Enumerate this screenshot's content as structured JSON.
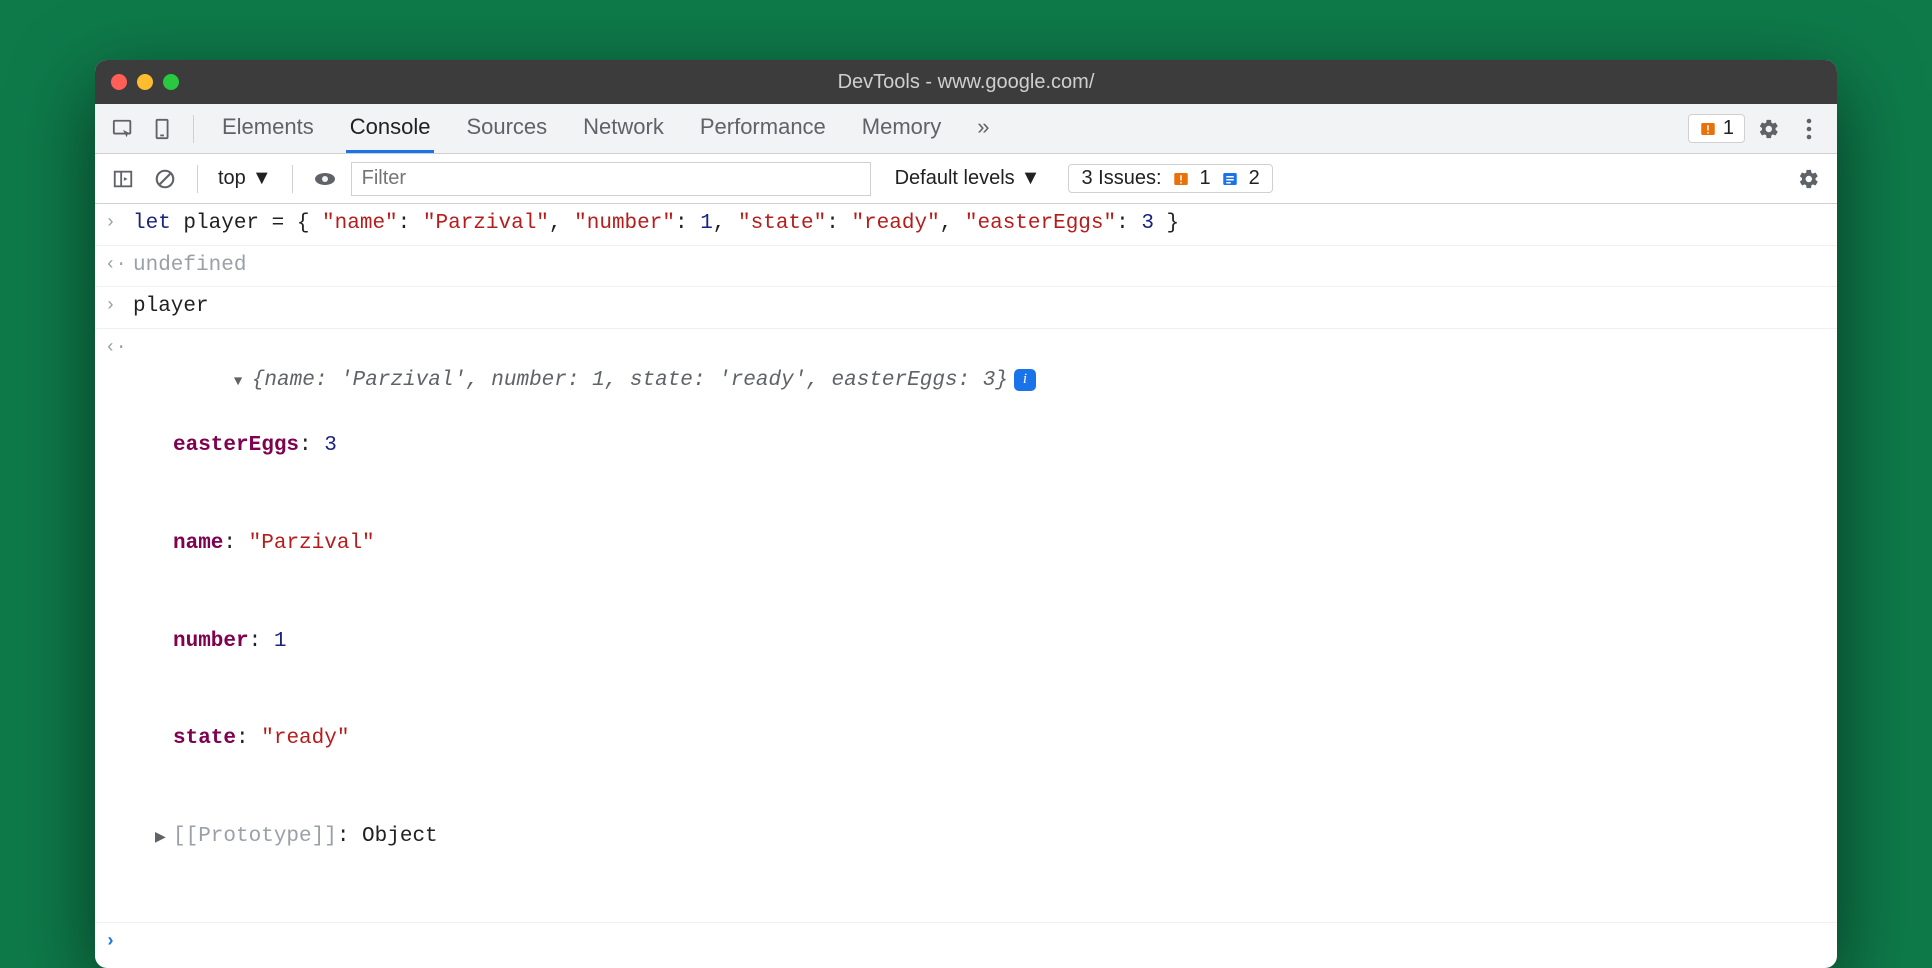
{
  "window": {
    "title": "DevTools - www.google.com/"
  },
  "tabs": {
    "items": [
      "Elements",
      "Console",
      "Sources",
      "Network",
      "Performance",
      "Memory"
    ],
    "active": "Console"
  },
  "toolbar": {
    "warn_badge_count": "1"
  },
  "subbar": {
    "context": "top",
    "filter_placeholder": "Filter",
    "levels_label": "Default levels",
    "issues_label": "3 Issues:",
    "issues_warn": "1",
    "issues_info": "2"
  },
  "console": {
    "input1_pre": "let",
    "input1_var": " player = { ",
    "input1_k1": "\"name\"",
    "input1_v1": "\"Parzival\"",
    "input1_k2": "\"number\"",
    "input1_v2": "1",
    "input1_k3": "\"state\"",
    "input1_v3": "\"ready\"",
    "input1_k4": "\"easterEggs\"",
    "input1_v4": "3",
    "result1": "undefined",
    "input2": "player",
    "summary": "{name: 'Parzival', number: 1, state: 'ready', easterEggs: 3}",
    "prop1_k": "easterEggs",
    "prop1_v": "3",
    "prop2_k": "name",
    "prop2_v": "\"Parzival\"",
    "prop3_k": "number",
    "prop3_v": "1",
    "prop4_k": "state",
    "prop4_v": "\"ready\"",
    "proto_k": "[[Prototype]]",
    "proto_v": "Object"
  }
}
